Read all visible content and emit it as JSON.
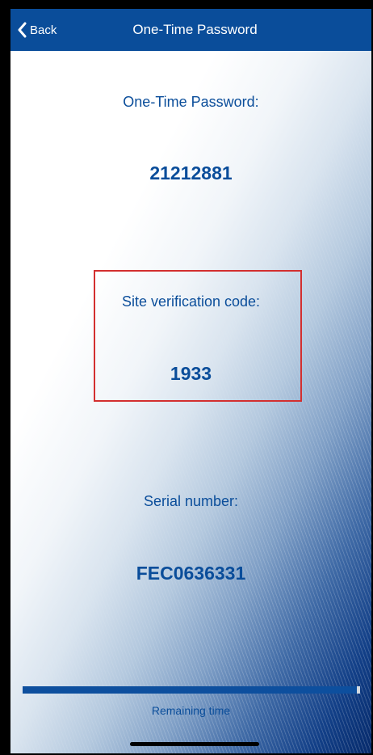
{
  "navbar": {
    "back_label": "Back",
    "title": "One-Time Password"
  },
  "otp": {
    "label": "One-Time Password:",
    "value": "21212881"
  },
  "site_verification": {
    "label": "Site verification code:",
    "value": "1933"
  },
  "serial": {
    "label": "Serial number:",
    "value": "FEC0636331"
  },
  "remaining_time": {
    "label": "Remaining time",
    "fraction_remaining": 0.99
  },
  "colors": {
    "brand_blue": "#0a4d9a",
    "highlight_red": "#d32f2f"
  }
}
